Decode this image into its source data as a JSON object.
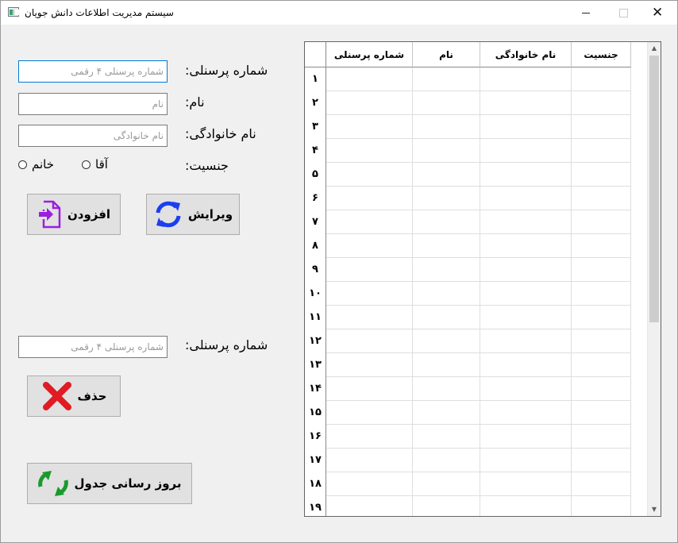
{
  "window": {
    "title": "سیستم مدیریت اطلاعات دانش جویان",
    "minimize_glyph": "—",
    "maximize_glyph": "☐",
    "close_glyph": "✕"
  },
  "form": {
    "personnel_label": "شماره پرسنلی:",
    "personnel_placeholder": "شماره پرسنلی ۴ رقمی",
    "name_label": "نام:",
    "name_placeholder": "نام",
    "family_label": "نام خانوادگی:",
    "family_placeholder": "نام خانوادگی",
    "gender_label": "جنسیت:",
    "gender_options": [
      "آقا",
      "خانم"
    ],
    "add_label": "افزودن",
    "edit_label": "ویرایش"
  },
  "delete_form": {
    "personnel_label": "شماره پرسنلی:",
    "personnel_placeholder": "شماره پرسنلی ۴ رقمی",
    "delete_label": "حذف"
  },
  "refresh_label": "بروز رسانی جدول",
  "table": {
    "columns": [
      "شماره پرسنلی",
      "نام",
      "نام خانوادگی",
      "جنسیت"
    ],
    "row_numbers": [
      "۱",
      "۲",
      "۳",
      "۴",
      "۵",
      "۶",
      "۷",
      "۸",
      "۹",
      "۱۰",
      "۱۱",
      "۱۲",
      "۱۳",
      "۱۴",
      "۱۵",
      "۱۶",
      "۱۷",
      "۱۸",
      "۱۹"
    ]
  },
  "icons": {
    "add": "add-user-icon",
    "edit": "refresh-arrows-icon",
    "delete": "red-x-icon",
    "refresh": "green-arrows-icon"
  },
  "colors": {
    "accent_purple": "#9b1ee0",
    "edit_blue": "#1a3ff0",
    "delete_red": "#e01b24",
    "refresh_green": "#1a9a2e"
  }
}
